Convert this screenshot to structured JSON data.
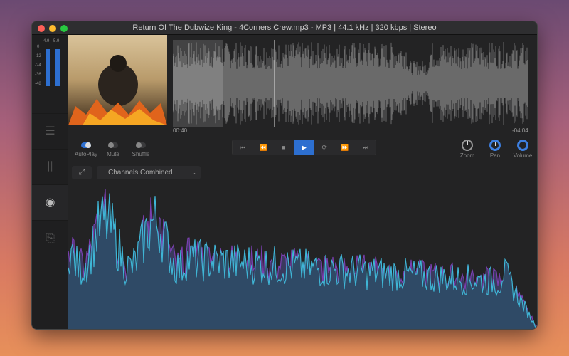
{
  "window": {
    "title": "Return Of The Dubwize King - 4Corners Crew.mp3 - MP3 | 44.1 kHz | 320 kbps | Stereo"
  },
  "meter": {
    "peak_left": "4.9",
    "peak_right": "5.9",
    "scale": [
      "0",
      "-12",
      "-24",
      "-36",
      "-48"
    ]
  },
  "sidebar": {
    "items": [
      {
        "icon": "list-icon"
      },
      {
        "icon": "sliders-icon"
      },
      {
        "icon": "eye-icon",
        "active": true
      },
      {
        "icon": "export-icon"
      }
    ]
  },
  "player": {
    "elapsed": "00:40",
    "remaining": "-04:04",
    "progress": 0.14
  },
  "toggles": [
    {
      "label": "AutoPlay",
      "on": true
    },
    {
      "label": "Mute",
      "on": false
    },
    {
      "label": "Shuffle",
      "on": false
    }
  ],
  "transport": [
    "skip-back-icon",
    "rewind-icon",
    "stop-icon",
    "play-icon",
    "loop-icon",
    "fast-forward-icon",
    "skip-forward-icon"
  ],
  "knobs": [
    {
      "label": "Zoom"
    },
    {
      "label": "Pan"
    },
    {
      "label": "Volume"
    }
  ],
  "view": {
    "channel_mode": "Channels Combined"
  },
  "colors": {
    "accent": "#2d6fd0",
    "spectrum_cyan": "#3fb6d6",
    "spectrum_purple": "#7a3fb0",
    "spectrum_fill": "#2f4a66"
  }
}
